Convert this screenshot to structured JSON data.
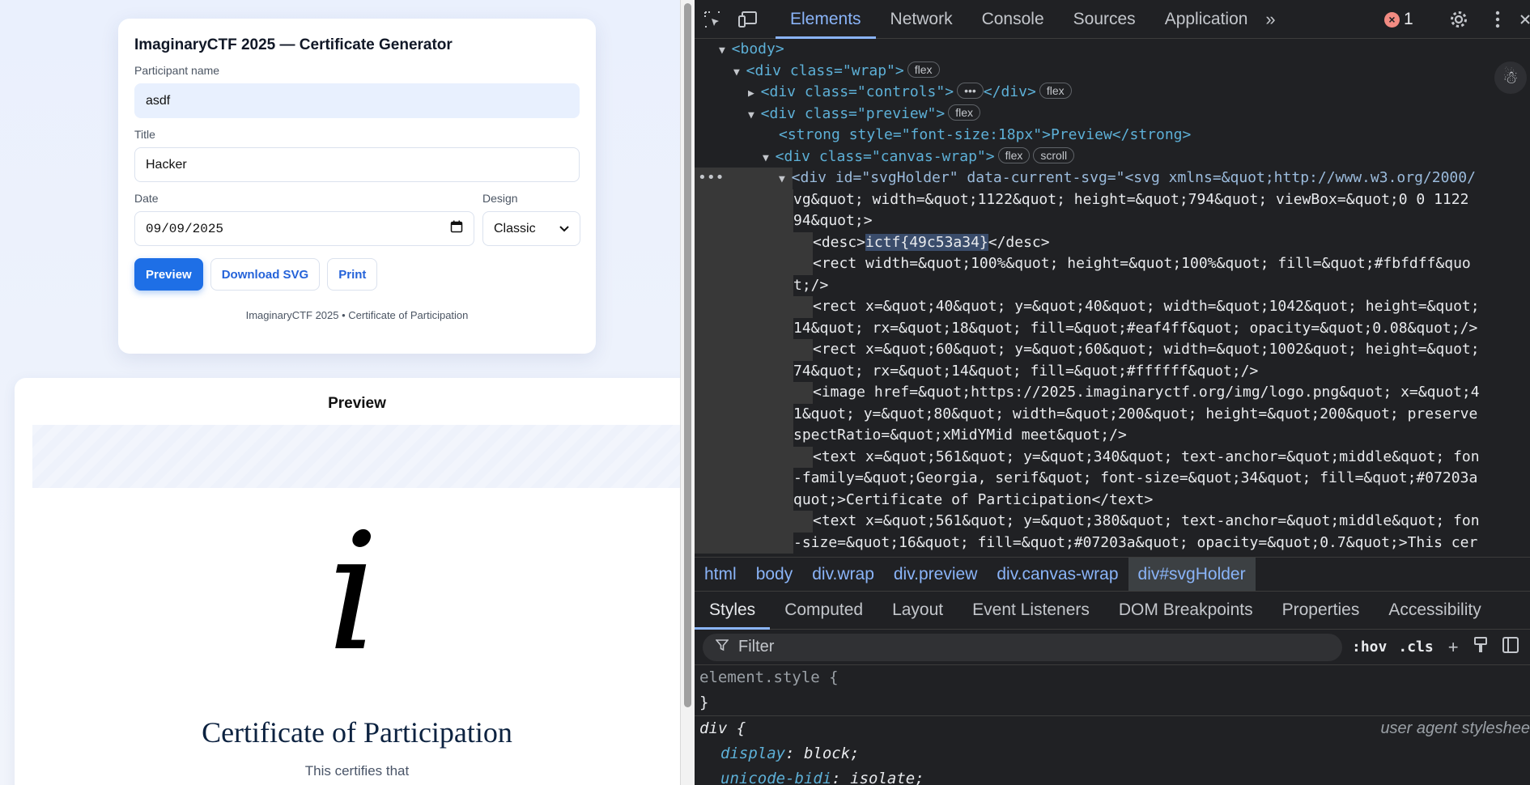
{
  "form": {
    "title": "ImaginaryCTF 2025 — Certificate Generator",
    "name_label": "Participant name",
    "name_value": "asdf",
    "title_label": "Title",
    "title_value": "Hacker",
    "date_label": "Date",
    "date_value": "09/09/2025",
    "design_label": "Design",
    "design_value": "Classic",
    "preview_button": "Preview",
    "download_button": "Download SVG",
    "print_button": "Print",
    "footer": "ImaginaryCTF 2025 • Certificate of Participation"
  },
  "preview": {
    "title": "Preview",
    "logo_glyph": "i",
    "heading": "Certificate of Participation",
    "subtitle": "This certifies that"
  },
  "devtools": {
    "tabs": [
      "Elements",
      "Network",
      "Console",
      "Sources",
      "Application"
    ],
    "error_count": "1",
    "tree": [
      "<body>",
      "<div class=\"wrap\">",
      "<div class=\"controls\">",
      "<div class=\"preview\">",
      "<strong style=\"font-size:18px\">Preview</strong>",
      "<div class=\"canvas-wrap\">",
      "<div id=\"svgHolder\" data-current-svg=\"<svg xmlns=&quot;http://www.w3.org/2000/",
      "vg&quot; width=&quot;1122&quot; height=&quot;794&quot; viewBox=&quot;0 0 1122",
      "94&quot;>",
      "<desc>",
      "ictf{49c53a34}",
      "</desc>",
      "<rect width=&quot;100%&quot; height=&quot;100%&quot; fill=&quot;#fbfdff&quo",
      "t;/>",
      "<rect x=&quot;40&quot; y=&quot;40&quot; width=&quot;1042&quot; height=&quot;",
      "14&quot; rx=&quot;18&quot; fill=&quot;#eaf4ff&quot; opacity=&quot;0.08&quot;/>",
      "<rect x=&quot;60&quot; y=&quot;60&quot; width=&quot;1002&quot; height=&quot;",
      "74&quot; rx=&quot;14&quot; fill=&quot;#ffffff&quot;/>",
      "<image href=&quot;https://2025.imaginaryctf.org/img/logo.png&quot; x=&quot;4",
      "1&quot; y=&quot;80&quot; width=&quot;200&quot; height=&quot;200&quot; preserve",
      "spectRatio=&quot;xMidYMid meet&quot;/>",
      "<text x=&quot;561&quot; y=&quot;340&quot; text-anchor=&quot;middle&quot; fon",
      "-family=&quot;Georgia, serif&quot; font-size=&quot;34&quot; fill=&quot;#07203a",
      "quot;>Certificate of Participation</text>",
      "<text x=&quot;561&quot; y=&quot;380&quot; text-anchor=&quot;middle&quot; fon",
      "-size=&quot;16&quot; fill=&quot;#07203a&quot; opacity=&quot;0.7&quot;>This cer"
    ],
    "pills": [
      "flex",
      "flex",
      "flex",
      "flex",
      "scroll"
    ],
    "breadcrumbs": [
      "html",
      "body",
      "div.wrap",
      "div.preview",
      "div.canvas-wrap",
      "div#svgHolder"
    ],
    "style_tabs": [
      "Styles",
      "Computed",
      "Layout",
      "Event Listeners",
      "DOM Breakpoints",
      "Properties",
      "Accessibility"
    ],
    "filter_placeholder": "Filter",
    "hov": ":hov",
    "cls": ".cls",
    "styles": {
      "element_style": "element.style {",
      "close": "}",
      "div_selector": "div {",
      "ua_label": "user agent styleshee",
      "prop1": "display",
      "val1": "block;",
      "prop2": "unicode-bidi",
      "val2": "isolate;"
    }
  }
}
